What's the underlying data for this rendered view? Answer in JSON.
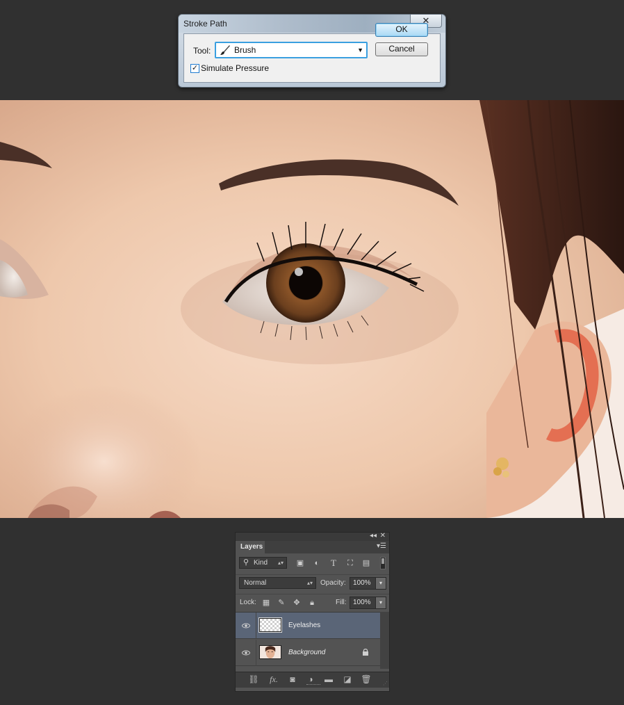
{
  "dialog": {
    "title": "Stroke Path",
    "close_glyph": "✕",
    "tool_label": "Tool:",
    "tool_value": "Brush",
    "tool_icon": "brush-icon",
    "simulate_pressure_label": "Simulate Pressure",
    "simulate_pressure_checked": true,
    "ok_label": "OK",
    "cancel_label": "Cancel"
  },
  "canvas": {
    "image": "close-up portrait photo showing eye, eyebrow, nose and ear with earring"
  },
  "layers_panel": {
    "tab_label": "Layers",
    "filter_kind": "Kind",
    "filter_icons": [
      "image-filter-icon",
      "adjustment-filter-icon",
      "type-filter-icon",
      "shape-filter-icon",
      "smart-object-filter-icon"
    ],
    "blend_mode": "Normal",
    "opacity_label": "Opacity:",
    "opacity_value": "100%",
    "lock_label": "Lock:",
    "fill_label": "Fill:",
    "fill_value": "100%",
    "layers": [
      {
        "name": "Eyelashes",
        "visible": true,
        "selected": true,
        "locked": false,
        "thumbnail": "transparent"
      },
      {
        "name": "Background",
        "visible": true,
        "selected": false,
        "locked": true,
        "thumbnail": "portrait"
      }
    ],
    "footer_icons": [
      "link-layers-icon",
      "fx-icon",
      "add-mask-icon",
      "adjustment-layer-icon",
      "new-group-icon",
      "new-layer-icon",
      "delete-layer-icon"
    ]
  }
}
